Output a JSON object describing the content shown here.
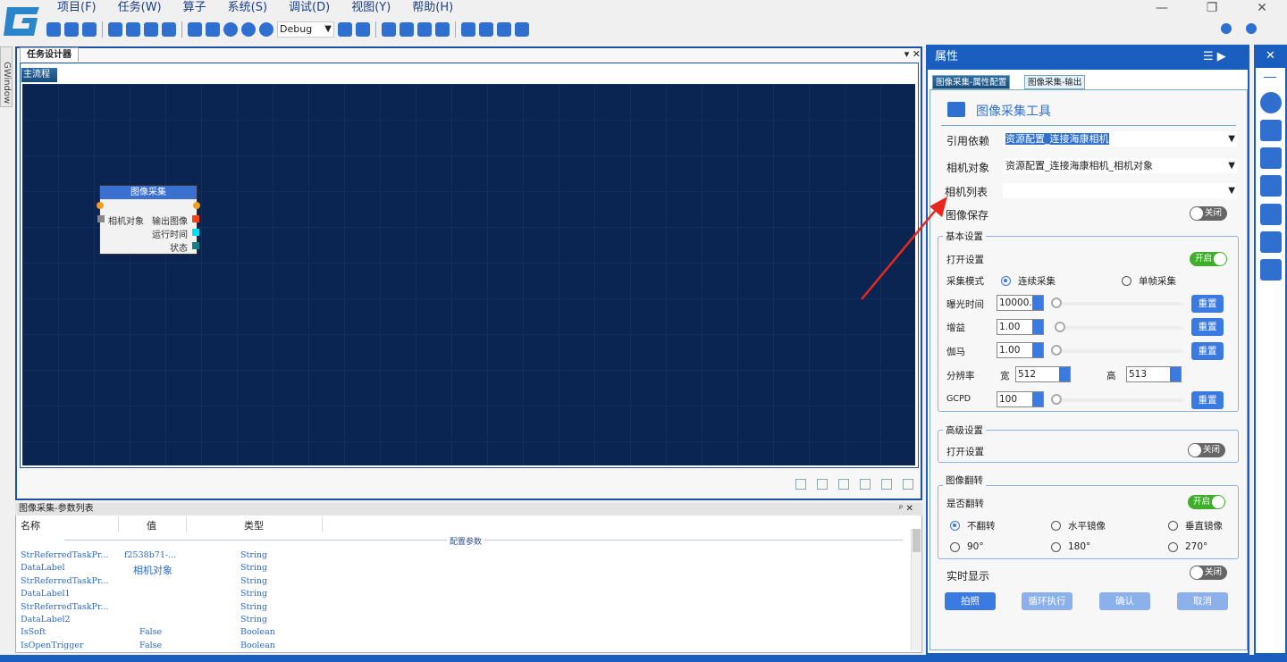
{
  "menu": [
    "项目(F)",
    "任务(W)",
    "算子",
    "系统(S)",
    "调试(D)",
    "视图(Y)",
    "帮助(H)"
  ],
  "window_controls": [
    "—",
    "❐",
    "✕"
  ],
  "toolbar": {
    "mode": "Debug"
  },
  "left_strip": {
    "label": "GWindow"
  },
  "designer": {
    "tab": "任务设计器",
    "controls": "▾ ✕",
    "flow_tab": "主流程"
  },
  "node": {
    "title": "图像采集",
    "input": "相机对象",
    "outputs": [
      "输出图像",
      "运行时间",
      "状态"
    ],
    "port_colors": [
      "#f0a020",
      "#888888",
      "#ff4010",
      "#00e0f0",
      "#108080"
    ]
  },
  "params": {
    "title": "图像采集-参数列表",
    "controls": "ᵖ ✕",
    "columns": [
      "名称",
      "值",
      "类型"
    ],
    "group": "配置参数",
    "rows": [
      [
        "StrReferredTaskPr...",
        "f2538b71-...",
        "String"
      ],
      [
        "DataLabel",
        "相机对象",
        "String"
      ],
      [
        "StrReferredTaskPr...",
        "",
        "String"
      ],
      [
        "DataLabel1",
        "",
        "String"
      ],
      [
        "StrReferredTaskPr...",
        "",
        "String"
      ],
      [
        "DataLabel2",
        "",
        "String"
      ],
      [
        "IsSoft",
        "False",
        "Boolean"
      ],
      [
        "IsOpenTrigger",
        "False",
        "Boolean"
      ]
    ]
  },
  "props": {
    "title": "属性",
    "tabs": [
      "图像采集-属性配置",
      "图像采集-输出"
    ],
    "tool_title": "图像采集工具",
    "ref_label": "引用依赖",
    "ref_value": "资源配置_连接海康相机",
    "cam_label": "相机对象",
    "cam_value": "资源配置_连接海康相机_相机对象",
    "list_label": "相机列表",
    "list_value": "",
    "save_label": "图像保存",
    "off": "关闭",
    "on": "开启",
    "basic": {
      "title": "基本设置",
      "open": "打开设置",
      "mode": "采集模式",
      "continuous": "连续采集",
      "single": "单帧采集",
      "exposure": "曝光时间",
      "exposure_val": "10000.0",
      "gain": "增益",
      "gain_val": "1.00",
      "gamma": "伽马",
      "gamma_val": "1.00",
      "res": "分辨率",
      "w": "宽",
      "w_val": "512",
      "h": "高",
      "h_val": "513",
      "gcpd": "GCPD",
      "gcpd_val": "100",
      "reset": "重置"
    },
    "adv": {
      "title": "高级设置",
      "open": "打开设置"
    },
    "flip": {
      "title": "图像翻转",
      "enable": "是否翻转",
      "opts": [
        "不翻转",
        "水平镜像",
        "垂直镜像",
        "90°",
        "180°",
        "270°"
      ]
    },
    "realtime": "实时显示",
    "buttons": [
      "拍照",
      "循环执行",
      "确认",
      "取消"
    ]
  },
  "colors": {
    "accent": "#1a5fbf",
    "canvas": "#0b2552",
    "arrow": "#e8281e"
  }
}
